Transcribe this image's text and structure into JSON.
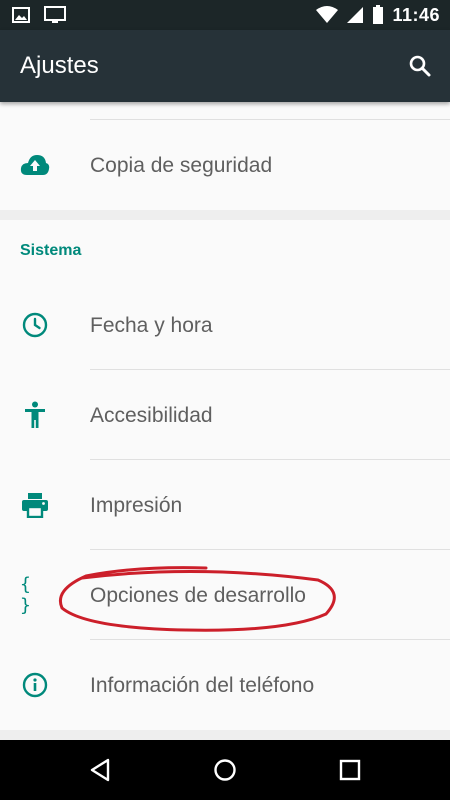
{
  "status_bar": {
    "time": "11:46",
    "icons": [
      "image-icon",
      "cast-screen-icon",
      "wifi-icon",
      "signal-icon",
      "battery-icon"
    ]
  },
  "toolbar": {
    "title": "Ajustes",
    "search_icon": "search-icon"
  },
  "top_card": {
    "items": [
      {
        "label": "Copia de seguridad",
        "icon": "cloud-upload-icon"
      }
    ]
  },
  "sistema": {
    "header": "Sistema",
    "items": [
      {
        "label": "Fecha y hora",
        "icon": "clock-icon"
      },
      {
        "label": "Accesibilidad",
        "icon": "accessibility-icon"
      },
      {
        "label": "Impresión",
        "icon": "printer-icon"
      },
      {
        "label": "Opciones de desarrollo",
        "icon": "braces-icon",
        "icon_text": "{ }"
      },
      {
        "label": "Información del teléfono",
        "icon": "info-icon"
      }
    ]
  },
  "nav_bar": {
    "buttons": [
      "back-icon",
      "home-icon",
      "recents-icon"
    ]
  },
  "colors": {
    "accent": "#00897b",
    "toolbar": "#263238",
    "status_bar": "#1c2628",
    "annotation": "#cc1f2a"
  }
}
